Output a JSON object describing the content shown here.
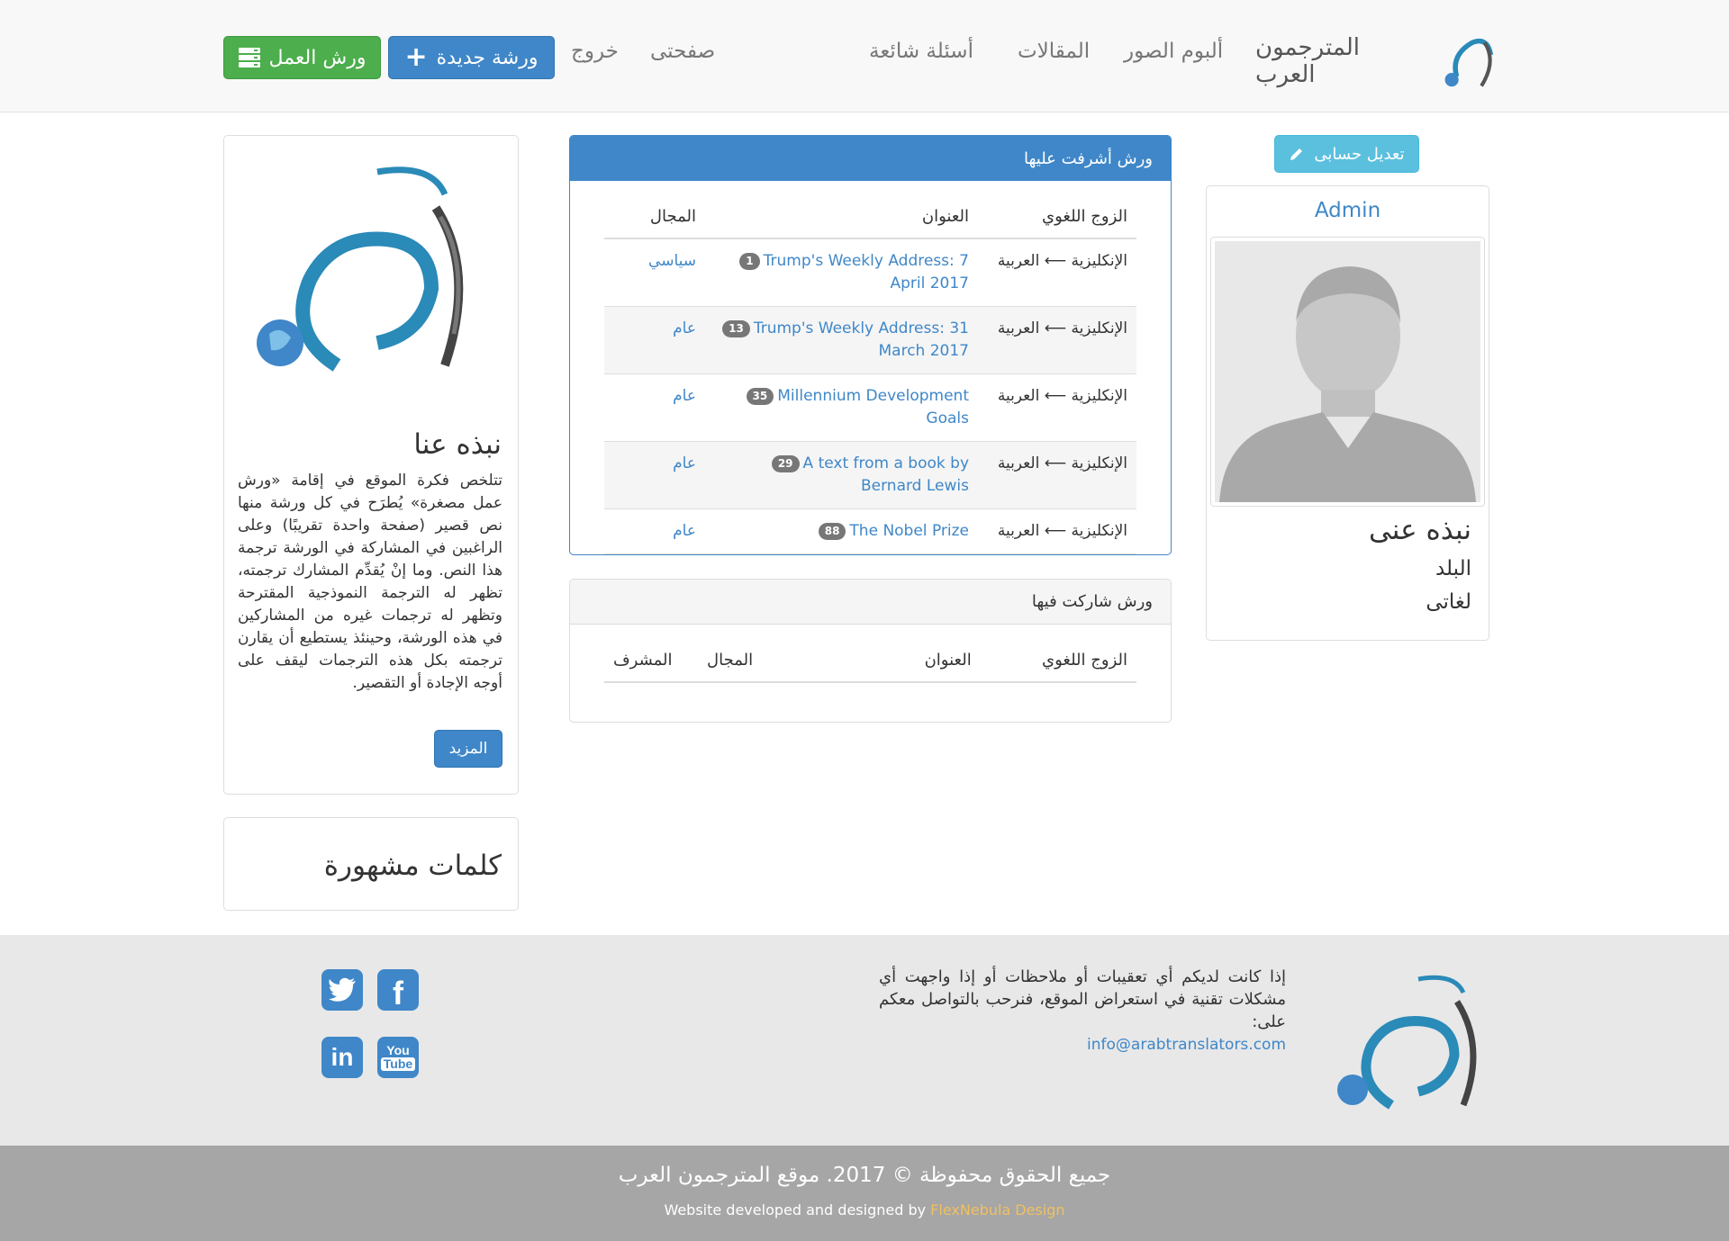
{
  "nav": {
    "brand": "المترجمون العرب",
    "links": [
      "ألبوم الصور",
      "المقالات",
      "أسئلة شائعة",
      "صفحتى",
      "خروج"
    ],
    "new_workshop": "ورشة جديدة",
    "workshops": "ورش العمل"
  },
  "profile": {
    "edit_button": "تعديل حسابى",
    "username": "Admin",
    "about_heading": "نبذه عنى",
    "country_label": "البلد",
    "languages_label": "لغاتى"
  },
  "supervised": {
    "heading": "ورش أشرفت عليها",
    "columns": [
      "الزوج اللغوي",
      "العنوان",
      "المجال"
    ],
    "rows": [
      {
        "pair": "الإنكليزية ⟵ العربية",
        "title": "Trump's Weekly Address: 7 April 2017",
        "count": "1",
        "field": "سياسي"
      },
      {
        "pair": "الإنكليزية ⟵ العربية",
        "title": "Trump's Weekly Address: 31 March 2017",
        "count": "13",
        "field": "عام"
      },
      {
        "pair": "الإنكليزية ⟵ العربية",
        "title": "Millennium Development Goals",
        "count": "35",
        "field": "عام"
      },
      {
        "pair": "الإنكليزية ⟵ العربية",
        "title": "A text from a book by Bernard Lewis",
        "count": "29",
        "field": "عام"
      },
      {
        "pair": "الإنكليزية ⟵ العربية",
        "title": "The Nobel Prize",
        "count": "88",
        "field": "عام"
      }
    ]
  },
  "participated": {
    "heading": "ورش شاركت فيها",
    "columns": [
      "الزوج اللغوي",
      "العنوان",
      "المجال",
      "المشرف"
    ]
  },
  "about": {
    "heading": "نبذه عنا",
    "text": "تتلخص فكرة الموقع في إقامة «ورش عمل مصغرة» يُطرَح في كل ورشة منها نص قصير (صفحة واحدة تقريبًا) وعلى الراغبين في المشاركة في الورشة ترجمة هذا النص. وما إنْ يُقدِّم المشارك ترجمته، تظهر له الترجمة النموذجية المقترحة وتظهر له ترجمات غيره من المشاركين في هذه الورشة، وحينئذ يستطيع أن يقارن ترجمته بكل هذه الترجمات ليقف على أوجه الإجادة أو التقصير.",
    "more_button": "المزيد"
  },
  "tags": {
    "heading": "كلمات مشهورة"
  },
  "footer": {
    "contact_text": "إذا كانت لديكم أي تعقيبات أو ملاحظات أو إذا واجهت أي مشكلات تقنية في استعراض الموقع، فنرحب بالتواصل معكم على:",
    "email": "info@arabtranslators.com",
    "copyright": "جميع الحقوق محفوظة © 2017. موقع المترجمون العرب",
    "credit_prefix": "Website developed and designed by",
    "credit_link": "FlexNebula Design",
    "social": [
      "facebook-icon",
      "twitter-icon",
      "youtube-icon",
      "linkedin-icon"
    ]
  },
  "colors": {
    "primary": "#3f87c8",
    "success": "#4cae4c",
    "info": "#5bc0de",
    "credit": "#f0c060"
  }
}
